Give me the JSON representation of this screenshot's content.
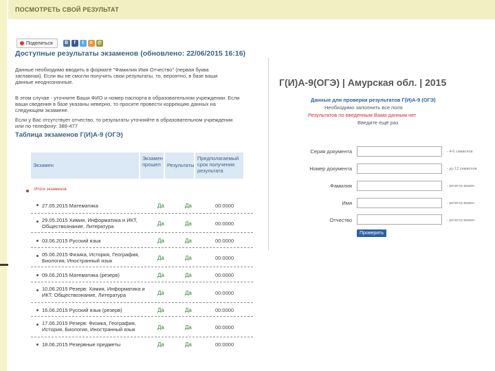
{
  "header": {
    "title": "ПОСМОТРЕТЬ СВОЙ РЕЗУЛЬТАТ"
  },
  "share": {
    "label": "Поделиться",
    "icons": [
      "vk-icon",
      "facebook-icon",
      "twitter-icon",
      "odnoklassniki-icon",
      "mail-icon"
    ]
  },
  "left": {
    "title": "Доступные результаты экзаменов (обновлено: 22/06/2015 16:16)",
    "para1": "Данные необходимо вводить в формате \"Фамилия Имя Отчество\" (первая буква заглавная). Если вы не смогли получить свои результаты, то, вероятно, в базе ваши данные неоднозначные.",
    "para2": "В этом случае - уточните Ваши ФИО и номер паспорта в образовательном учреждении. Если ваши сведения в базе указаны неверно, то просите провести коррекцию данных на следующем экзамене.",
    "para3": "Если у Вас отсутствует отчество, то результаты уточняйте в образовательном учреждении или по телефону: 388-477",
    "table_title": "Таблица экзаменов Г(И)А-9 (ОГЭ)",
    "columns": [
      "Экзамен",
      "Экзамен прошел",
      "Результаты",
      "Предполагаемый срок получения результата"
    ],
    "legend": "Итоги экзаменов",
    "rows": [
      {
        "date": "27.05.2015 Математика",
        "passed": "Да",
        "results": "Да",
        "score": "00:0000"
      },
      {
        "date": "29.05.2015 Химия, Информатика и ИКТ, Обществознание, Литература",
        "passed": "Да",
        "results": "Да",
        "score": "00:0000"
      },
      {
        "date": "03.06.2015 Русский язык",
        "passed": "Да",
        "results": "Да",
        "score": "00:0000"
      },
      {
        "date": "05.06.2015 Физика, История, География, Биология, Иностранный язык",
        "passed": "Да",
        "results": "Да",
        "score": "00:0000"
      },
      {
        "date": "09.06.2015 Математика (резерв)",
        "passed": "Да",
        "results": "Да",
        "score": "00:0000"
      },
      {
        "date": "10.06.2015 Резерв: Химия, Информатика и ИКТ, Обществознание, Литература",
        "passed": "Да",
        "results": "Да",
        "score": "00:0000"
      },
      {
        "date": "16.06.2015 Русский язык (резерв)",
        "passed": "Да",
        "results": "Да",
        "score": "00:0000"
      },
      {
        "date": "17.06.2015 Резерв: Физика, География, История, Биология, Иностранный язык",
        "passed": "Да",
        "results": "Да",
        "score": "00:0000"
      },
      {
        "date": "18.06.2015 Резервные предметы",
        "passed": "Да",
        "results": "Да",
        "score": "00:0000"
      }
    ]
  },
  "right": {
    "title": "Г(И)А-9(ОГЭ) | Амурская обл. | 2015",
    "sub1": "Данные для проверки результатов Г(И)А-9 (ОГЭ)",
    "sub2": "Необходимо заполнить все поля",
    "sub3": "Результатов по введенным Вами данным нет",
    "sub4": "Введите ещё раз",
    "fields": [
      {
        "label": "Серия документа",
        "hint": "- 4-6 символов"
      },
      {
        "label": "Номер документа",
        "hint": "- до 12 символов"
      },
      {
        "label": "Фамилия",
        "hint": "- регистр важен"
      },
      {
        "label": "Имя",
        "hint": "- регистр важен"
      },
      {
        "label": "Отчество",
        "hint": "- регистр важен"
      }
    ],
    "button": "Проверить"
  },
  "colors": {
    "accent": "#3d5f86",
    "error": "#c0392b",
    "ok": "#2f7d2f",
    "button": "#2a5fa8"
  }
}
